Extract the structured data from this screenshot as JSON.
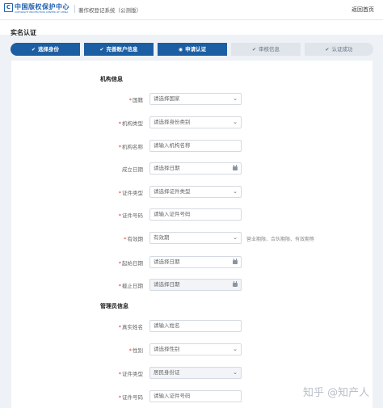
{
  "header": {
    "logo_mark": "C",
    "logo_text": "中国版权保护中心",
    "logo_subtitle": "COPYRIGHT PROTECTION CENTER OF CHINA",
    "system_title": "著作权登记系统（公测版）",
    "home_link": "返回首页"
  },
  "page_title": "实名认证",
  "steps": [
    {
      "label": "选择身份",
      "icon": "check-circle",
      "state": "done"
    },
    {
      "label": "完善账户信息",
      "icon": "check-circle",
      "state": "done"
    },
    {
      "label": "申请认证",
      "icon": "dot-circle",
      "state": "current"
    },
    {
      "label": "审核信息",
      "icon": "check-circle",
      "state": "todo"
    },
    {
      "label": "认证成功",
      "icon": "check-circle",
      "state": "todo"
    }
  ],
  "org_section": {
    "title": "机构信息",
    "fields": [
      {
        "label": "国籍",
        "required": true,
        "value": "请选择国家",
        "type": "select"
      },
      {
        "label": "机构类型",
        "required": true,
        "value": "请选择身份类别",
        "type": "select"
      },
      {
        "label": "机构名称",
        "required": true,
        "value": "请输入机构名称",
        "type": "text"
      },
      {
        "label": "成立日期",
        "required": false,
        "value": "请选择日期",
        "type": "date"
      },
      {
        "label": "证件类型",
        "required": true,
        "value": "请选择证件类型",
        "type": "select"
      },
      {
        "label": "证件号码",
        "required": true,
        "value": "请输入证件号码",
        "type": "text"
      },
      {
        "label": "有效期",
        "required": true,
        "value": "有效期",
        "type": "select",
        "hint": "营业期限、合伙期限、有效期等"
      },
      {
        "label": "起始日期",
        "required": true,
        "value": "请选择日期",
        "type": "date"
      },
      {
        "label": "截止日期",
        "required": true,
        "value": "请选择日期",
        "type": "date",
        "disabled": true
      }
    ]
  },
  "admin_section": {
    "title": "管理员信息",
    "fields": [
      {
        "label": "真实姓名",
        "required": true,
        "value": "请输入姓名",
        "type": "text"
      },
      {
        "label": "性别",
        "required": true,
        "value": "请选择性别",
        "type": "select"
      },
      {
        "label": "证件类型",
        "required": true,
        "value": "居民身份证",
        "type": "select",
        "disabled": true
      },
      {
        "label": "证件号码",
        "required": true,
        "value": "请输入证件号码",
        "type": "text"
      }
    ]
  },
  "watermark": "知乎 @知产人",
  "colors": {
    "accent": "#1b5ea3",
    "step_inactive": "#dfe5eb",
    "required": "#dd3333",
    "page_bg": "#eef2f6"
  }
}
